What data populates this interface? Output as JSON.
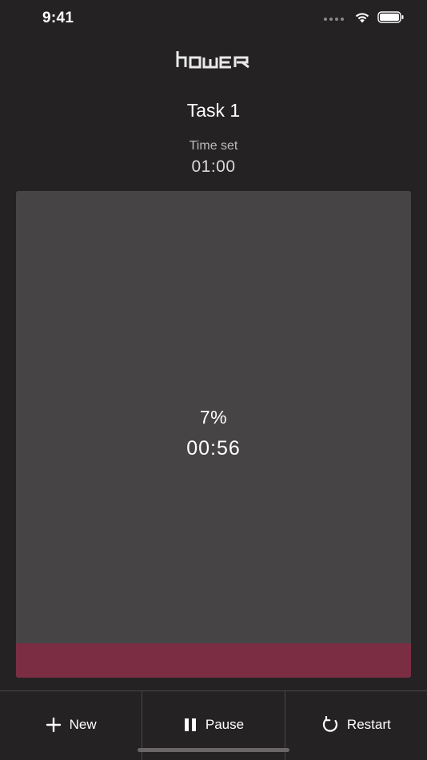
{
  "status_bar": {
    "time": "9:41",
    "icons": [
      "signal-dots-icon",
      "wifi-icon",
      "battery-icon"
    ]
  },
  "app": {
    "logo_text": "hower"
  },
  "task": {
    "title": "Task 1",
    "time_set_label": "Time set",
    "time_set_value": "01:00"
  },
  "timer": {
    "percent_text": "7%",
    "remaining": "00:56",
    "progress_fraction": 0.07
  },
  "toolbar": {
    "new_label": "New",
    "pause_label": "Pause",
    "restart_label": "Restart"
  },
  "colors": {
    "background": "#252223",
    "panel": "#474446",
    "progress": "#7a2d43"
  }
}
